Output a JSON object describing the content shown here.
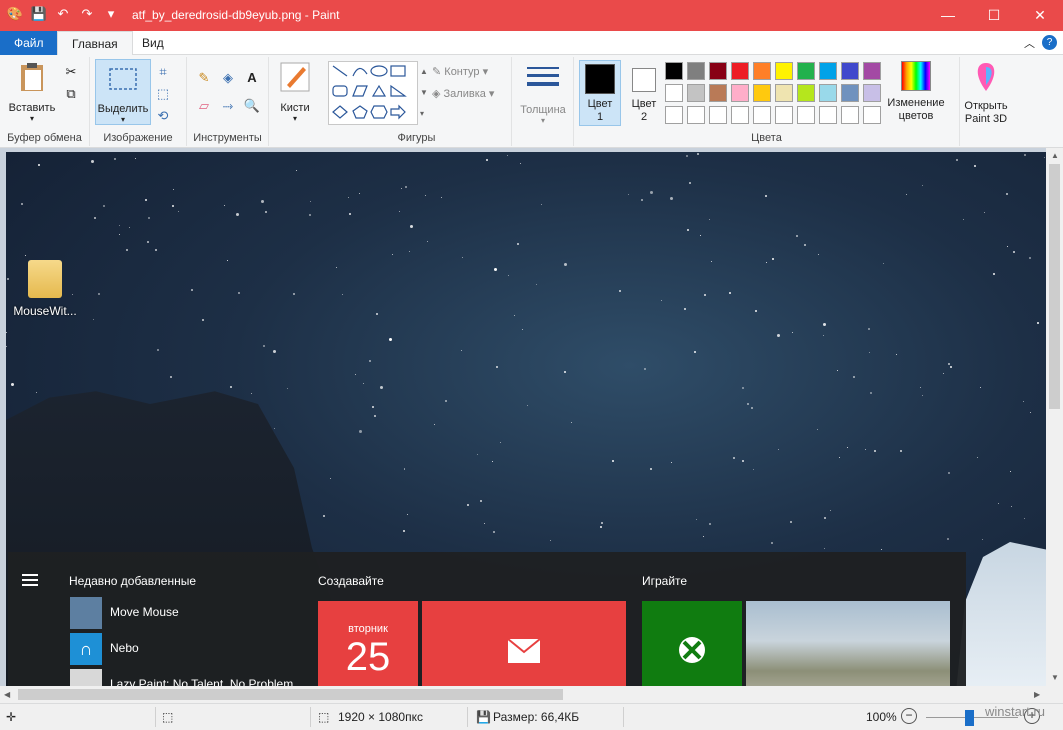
{
  "window": {
    "title": "atf_by_deredrosid-db9eyub.png - Paint",
    "minimize": "—",
    "maximize": "☐",
    "close": "✕"
  },
  "tabs": {
    "file": "Файл",
    "home": "Главная",
    "view": "Вид"
  },
  "ribbon": {
    "clipboard": {
      "label": "Буфер обмена",
      "paste": "Вставить"
    },
    "image": {
      "label": "Изображение",
      "select": "Выделить"
    },
    "tools": {
      "label": "Инструменты"
    },
    "brushes": {
      "label": "Кисти"
    },
    "shapes": {
      "label": "Фигуры",
      "outline": "Контур",
      "fill": "Заливка"
    },
    "thickness": {
      "label": "Толщина"
    },
    "colors": {
      "label": "Цвета",
      "color1": "Цвет 1",
      "color2": "Цвет 2",
      "edit": "Изменение цветов",
      "paint3d": "Открыть Paint 3D",
      "color1_value": "#000000",
      "color2_value": "#ffffff",
      "palette_row1": [
        "#000000",
        "#7f7f7f",
        "#880015",
        "#ed1c24",
        "#ff7f27",
        "#fff200",
        "#22b14c",
        "#00a2e8",
        "#3f48cc",
        "#a349a4"
      ],
      "palette_row2": [
        "#ffffff",
        "#c3c3c3",
        "#b97a57",
        "#ffaec9",
        "#ffc90e",
        "#efe4b0",
        "#b5e61d",
        "#99d9ea",
        "#7092be",
        "#c8bfe7"
      ]
    }
  },
  "desktop": {
    "icon_label": "MouseWit..."
  },
  "startmenu": {
    "recent_title": "Недавно добавленные",
    "recent": [
      "Move Mouse",
      "Nebo",
      "Lazy Paint: No Talent, No Problem"
    ],
    "create_title": "Создавайте",
    "play_title": "Играйте",
    "calendar_day": "вторник",
    "calendar_num": "25"
  },
  "status": {
    "dimensions": "1920 × 1080пкс",
    "size": "Размер: 66,4КБ",
    "zoom": "100%",
    "watermark": "winstart.ru"
  }
}
